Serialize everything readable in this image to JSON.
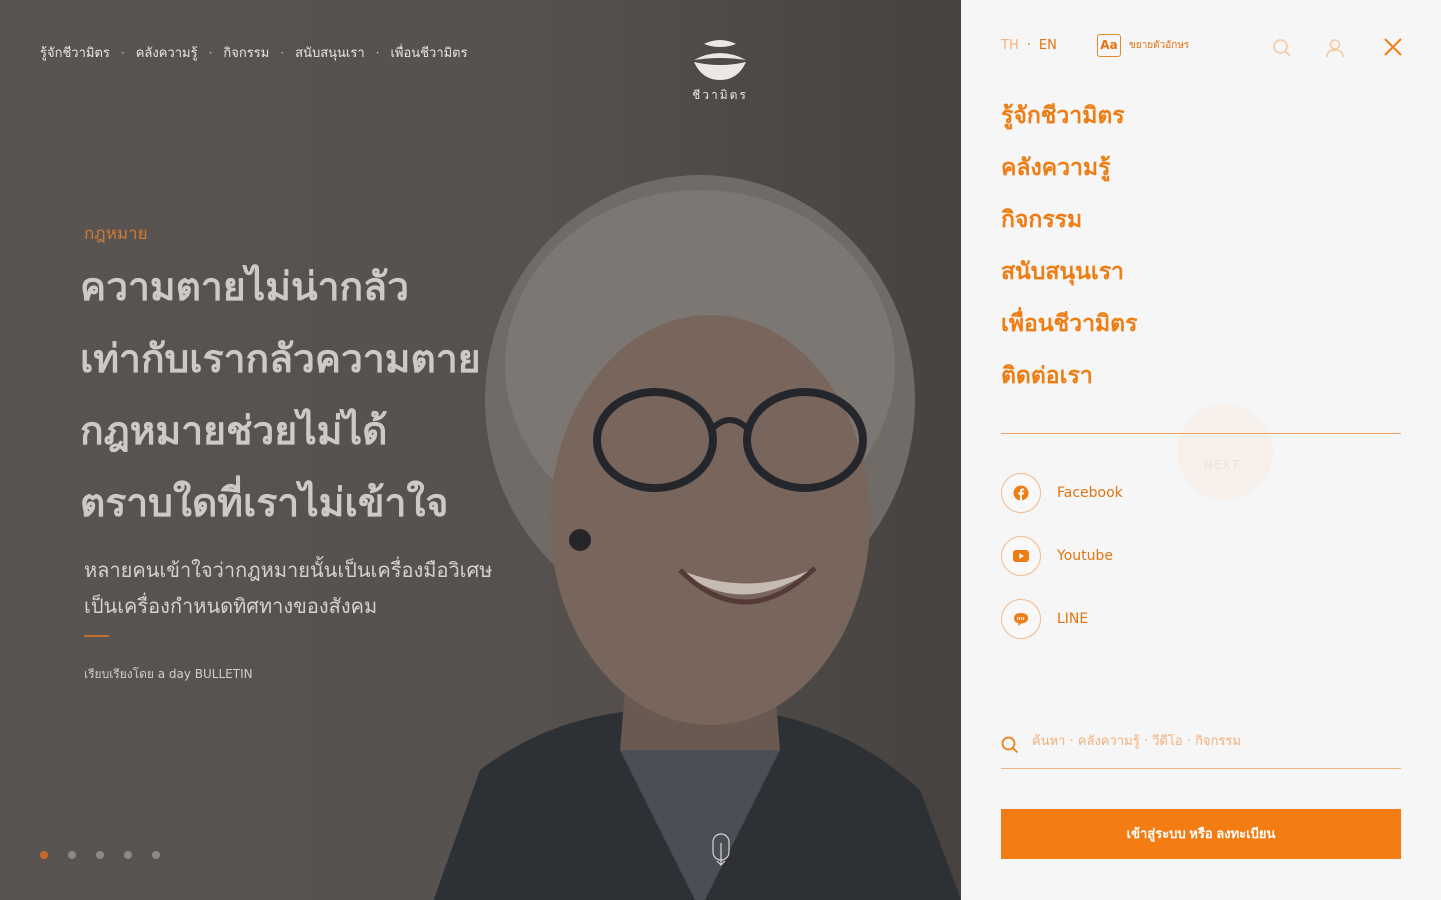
{
  "topnav": {
    "items": [
      "รู้จักชีวามิตร",
      "คลังความรู้",
      "กิจกรรม",
      "สนับสนุนเรา",
      "เพื่อนชีวามิตร"
    ],
    "separator": "·"
  },
  "logo": {
    "text": "ชีวามิตร"
  },
  "hero": {
    "category": "กฎหมาย",
    "headline": [
      "ความตายไม่น่ากลัว",
      "เท่ากับเรากลัวความตาย",
      "กฎหมายช่วยไม่ได้",
      "ตราบใดที่เราไม่เข้าใจ"
    ],
    "subtitle": [
      "หลายคนเข้าใจว่ากฎหมายนั้นเป็นเครื่องมือวิเศษ",
      "เป็นเครื่องกำหนดทิศทางของสังคม"
    ],
    "credit": "เรียบเรียงโดย a day BULLETIN",
    "slides_total": 5,
    "slide_active": 1
  },
  "panel": {
    "lang_th": "TH",
    "lang_sep": "·",
    "lang_en": "EN",
    "fontsize_box": "Aa",
    "fontsize_label": "ขยายตัวอักษร",
    "menu": [
      "รู้จักชีวามิตร",
      "คลังความรู้",
      "กิจกรรม",
      "สนับสนุนเรา",
      "เพื่อนชีวามิตร",
      "ติดต่อเรา"
    ],
    "ghost_text": "NEXT",
    "socials": [
      {
        "label": "Facebook",
        "icon": "facebook-icon"
      },
      {
        "label": "Youtube",
        "icon": "youtube-icon"
      },
      {
        "label": "LINE",
        "icon": "line-icon"
      }
    ],
    "search_placeholder": "ค้นหา · คลังความรู้ · วีดีโอ · กิจกรรม",
    "login_label": "เข้าสู่ระบบ หรือ ลงทะเบียน"
  },
  "colors": {
    "accent": "#f47d13",
    "menu_text": "#ee7d14",
    "hero_bg": "#5c5654",
    "panel_bg": "#f6f6f6"
  }
}
